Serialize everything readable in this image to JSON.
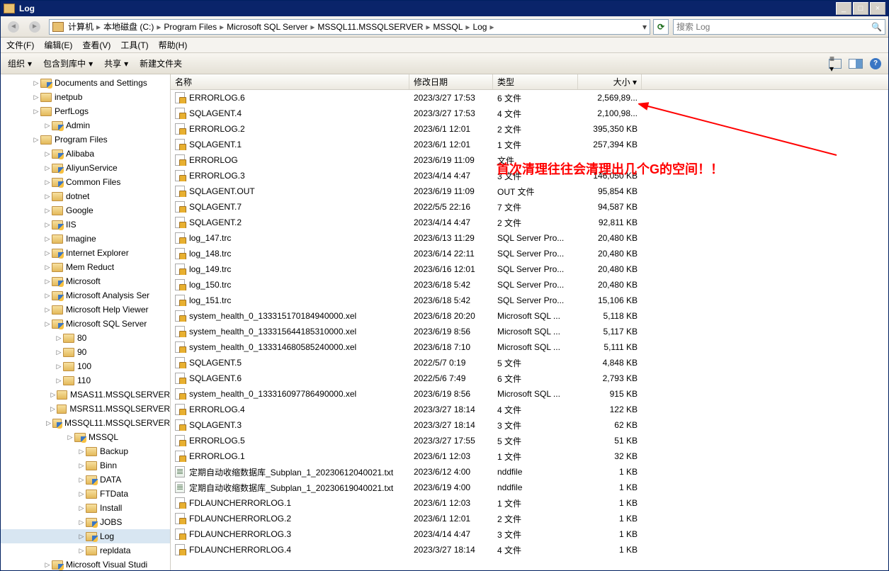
{
  "window": {
    "title": "Log"
  },
  "breadcrumbs": [
    "计算机",
    "本地磁盘 (C:)",
    "Program Files",
    "Microsoft SQL Server",
    "MSSQL11.MSSQLSERVER",
    "MSSQL",
    "Log"
  ],
  "search": {
    "placeholder": "搜索 Log"
  },
  "menus": {
    "file": "文件(F)",
    "edit": "编辑(E)",
    "view": "查看(V)",
    "tools": "工具(T)",
    "help": "帮助(H)"
  },
  "commands": {
    "organize": "组织",
    "include": "包含到库中",
    "share": "共享",
    "newfolder": "新建文件夹"
  },
  "columns": {
    "name": "名称",
    "date": "修改日期",
    "type": "类型",
    "size": "大小"
  },
  "tree": [
    {
      "label": "Documents and Settings",
      "level": 2,
      "shield": true
    },
    {
      "label": "inetpub",
      "level": 2
    },
    {
      "label": "PerfLogs",
      "level": 2
    },
    {
      "label": "Admin",
      "level": 3,
      "shield": true
    },
    {
      "label": "Program Files",
      "level": 2
    },
    {
      "label": "Alibaba",
      "level": 3,
      "shield": true
    },
    {
      "label": "AliyunService",
      "level": 3,
      "shield": true
    },
    {
      "label": "Common Files",
      "level": 3,
      "shield": true
    },
    {
      "label": "dotnet",
      "level": 3
    },
    {
      "label": "Google",
      "level": 3
    },
    {
      "label": "IIS",
      "level": 3,
      "shield": true
    },
    {
      "label": "Imagine",
      "level": 3
    },
    {
      "label": "Internet Explorer",
      "level": 3,
      "shield": true
    },
    {
      "label": "Mem Reduct",
      "level": 3
    },
    {
      "label": "Microsoft",
      "level": 3,
      "shield": true
    },
    {
      "label": "Microsoft Analysis Ser",
      "level": 3,
      "shield": true
    },
    {
      "label": "Microsoft Help Viewer",
      "level": 3
    },
    {
      "label": "Microsoft SQL Server",
      "level": 3,
      "shield": true
    },
    {
      "label": "80",
      "level": 4
    },
    {
      "label": "90",
      "level": 4
    },
    {
      "label": "100",
      "level": 4
    },
    {
      "label": "110",
      "level": 4
    },
    {
      "label": "MSAS11.MSSQLSERVER",
      "level": 4
    },
    {
      "label": "MSRS11.MSSQLSERVER",
      "level": 4
    },
    {
      "label": "MSSQL11.MSSQLSERVER",
      "level": 4,
      "shield": true
    },
    {
      "label": "MSSQL",
      "level": 5,
      "shield": true
    },
    {
      "label": "Backup",
      "level": 6
    },
    {
      "label": "Binn",
      "level": 6
    },
    {
      "label": "DATA",
      "level": 6,
      "shield": true
    },
    {
      "label": "FTData",
      "level": 6
    },
    {
      "label": "Install",
      "level": 6
    },
    {
      "label": "JOBS",
      "level": 6,
      "shield": true
    },
    {
      "label": "Log",
      "level": 6,
      "shield": true,
      "selected": true
    },
    {
      "label": "repldata",
      "level": 6
    },
    {
      "label": "Microsoft Visual Studi",
      "level": 3,
      "shield": true
    }
  ],
  "files": [
    {
      "name": "ERRORLOG.6",
      "date": "2023/3/27 17:53",
      "type": "6 文件",
      "size": "2,569,89...",
      "lock": true
    },
    {
      "name": "SQLAGENT.4",
      "date": "2023/3/27 17:53",
      "type": "4 文件",
      "size": "2,100,98...",
      "lock": true
    },
    {
      "name": "ERRORLOG.2",
      "date": "2023/6/1 12:01",
      "type": "2 文件",
      "size": "395,350 KB",
      "lock": true
    },
    {
      "name": "SQLAGENT.1",
      "date": "2023/6/1 12:01",
      "type": "1 文件",
      "size": "257,394 KB",
      "lock": true
    },
    {
      "name": "ERRORLOG",
      "date": "2023/6/19 11:09",
      "type": "文件",
      "size": "",
      "lock": true
    },
    {
      "name": "ERRORLOG.3",
      "date": "2023/4/14 4:47",
      "type": "3 文件",
      "size": "146,050 KB",
      "lock": true
    },
    {
      "name": "SQLAGENT.OUT",
      "date": "2023/6/19 11:09",
      "type": "OUT 文件",
      "size": "95,854 KB",
      "lock": true
    },
    {
      "name": "SQLAGENT.7",
      "date": "2022/5/5 22:16",
      "type": "7 文件",
      "size": "94,587 KB",
      "lock": true
    },
    {
      "name": "SQLAGENT.2",
      "date": "2023/4/14 4:47",
      "type": "2 文件",
      "size": "92,811 KB",
      "lock": true
    },
    {
      "name": "log_147.trc",
      "date": "2023/6/13 11:29",
      "type": "SQL Server Pro...",
      "size": "20,480 KB",
      "lock": true
    },
    {
      "name": "log_148.trc",
      "date": "2023/6/14 22:11",
      "type": "SQL Server Pro...",
      "size": "20,480 KB",
      "lock": true
    },
    {
      "name": "log_149.trc",
      "date": "2023/6/16 12:01",
      "type": "SQL Server Pro...",
      "size": "20,480 KB",
      "lock": true
    },
    {
      "name": "log_150.trc",
      "date": "2023/6/18 5:42",
      "type": "SQL Server Pro...",
      "size": "20,480 KB",
      "lock": true
    },
    {
      "name": "log_151.trc",
      "date": "2023/6/18 5:42",
      "type": "SQL Server Pro...",
      "size": "15,106 KB",
      "lock": true
    },
    {
      "name": "system_health_0_133315170184940000.xel",
      "date": "2023/6/18 20:20",
      "type": "Microsoft SQL ...",
      "size": "5,118 KB",
      "lock": true
    },
    {
      "name": "system_health_0_133315644185310000.xel",
      "date": "2023/6/19 8:56",
      "type": "Microsoft SQL ...",
      "size": "5,117 KB",
      "lock": true
    },
    {
      "name": "system_health_0_133314680585240000.xel",
      "date": "2023/6/18 7:10",
      "type": "Microsoft SQL ...",
      "size": "5,111 KB",
      "lock": true
    },
    {
      "name": "SQLAGENT.5",
      "date": "2022/5/7 0:19",
      "type": "5 文件",
      "size": "4,848 KB",
      "lock": true
    },
    {
      "name": "SQLAGENT.6",
      "date": "2022/5/6 7:49",
      "type": "6 文件",
      "size": "2,793 KB",
      "lock": true
    },
    {
      "name": "system_health_0_133316097786490000.xel",
      "date": "2023/6/19 8:56",
      "type": "Microsoft SQL ...",
      "size": "915 KB",
      "lock": true
    },
    {
      "name": "ERRORLOG.4",
      "date": "2023/3/27 18:14",
      "type": "4 文件",
      "size": "122 KB",
      "lock": true
    },
    {
      "name": "SQLAGENT.3",
      "date": "2023/3/27 18:14",
      "type": "3 文件",
      "size": "62 KB",
      "lock": true
    },
    {
      "name": "ERRORLOG.5",
      "date": "2023/3/27 17:55",
      "type": "5 文件",
      "size": "51 KB",
      "lock": true
    },
    {
      "name": "ERRORLOG.1",
      "date": "2023/6/1 12:03",
      "type": "1 文件",
      "size": "32 KB",
      "lock": true
    },
    {
      "name": "定期自动收缩数据库_Subplan_1_20230612040021.txt",
      "date": "2023/6/12 4:00",
      "type": "nddfile",
      "size": "1 KB",
      "txt": true
    },
    {
      "name": "定期自动收缩数据库_Subplan_1_20230619040021.txt",
      "date": "2023/6/19 4:00",
      "type": "nddfile",
      "size": "1 KB",
      "txt": true
    },
    {
      "name": "FDLAUNCHERRORLOG.1",
      "date": "2023/6/1 12:03",
      "type": "1 文件",
      "size": "1 KB",
      "lock": true
    },
    {
      "name": "FDLAUNCHERRORLOG.2",
      "date": "2023/6/1 12:01",
      "type": "2 文件",
      "size": "1 KB",
      "lock": true
    },
    {
      "name": "FDLAUNCHERRORLOG.3",
      "date": "2023/4/14 4:47",
      "type": "3 文件",
      "size": "1 KB",
      "lock": true
    },
    {
      "name": "FDLAUNCHERRORLOG.4",
      "date": "2023/3/27 18:14",
      "type": "4 文件",
      "size": "1 KB",
      "lock": true
    }
  ],
  "annotation": "首次清理往往会清理出几个G的空间！！"
}
